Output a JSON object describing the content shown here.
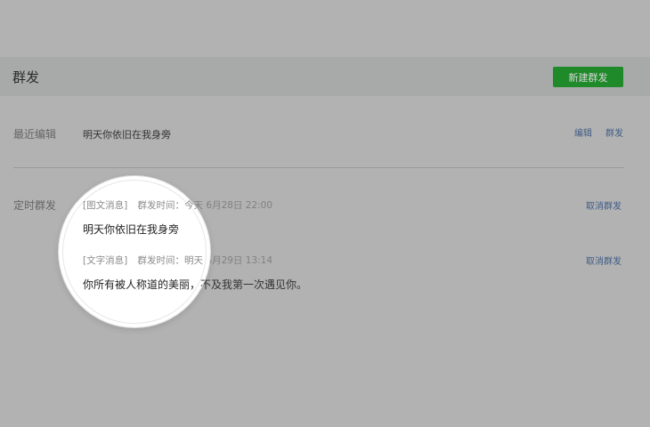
{
  "header": {
    "title": "群发",
    "new_button": "新建群发"
  },
  "recent": {
    "label": "最近编辑",
    "draft_title": "明天你依旧在我身旁",
    "actions": {
      "edit": "编辑",
      "send": "群发"
    }
  },
  "scheduled": {
    "label": "定时群发",
    "items": [
      {
        "type_tag": "[图文消息]",
        "time_label": "群发时间：",
        "day": "今天",
        "date_time": "6月28日 22:00",
        "text": "明天你依旧在我身旁",
        "cancel": "取消群发"
      },
      {
        "type_tag": "[文字消息]",
        "time_label": "群发时间：",
        "day": "明天",
        "date_time": "6月29日 13:14",
        "text": "你所有被人称道的美丽，不及我第一次遇见你。",
        "cancel": "取消群发"
      }
    ]
  },
  "colors": {
    "accent_button": "#1f8a2a",
    "link": "#415d86",
    "overlay": "#b2b2b2"
  }
}
